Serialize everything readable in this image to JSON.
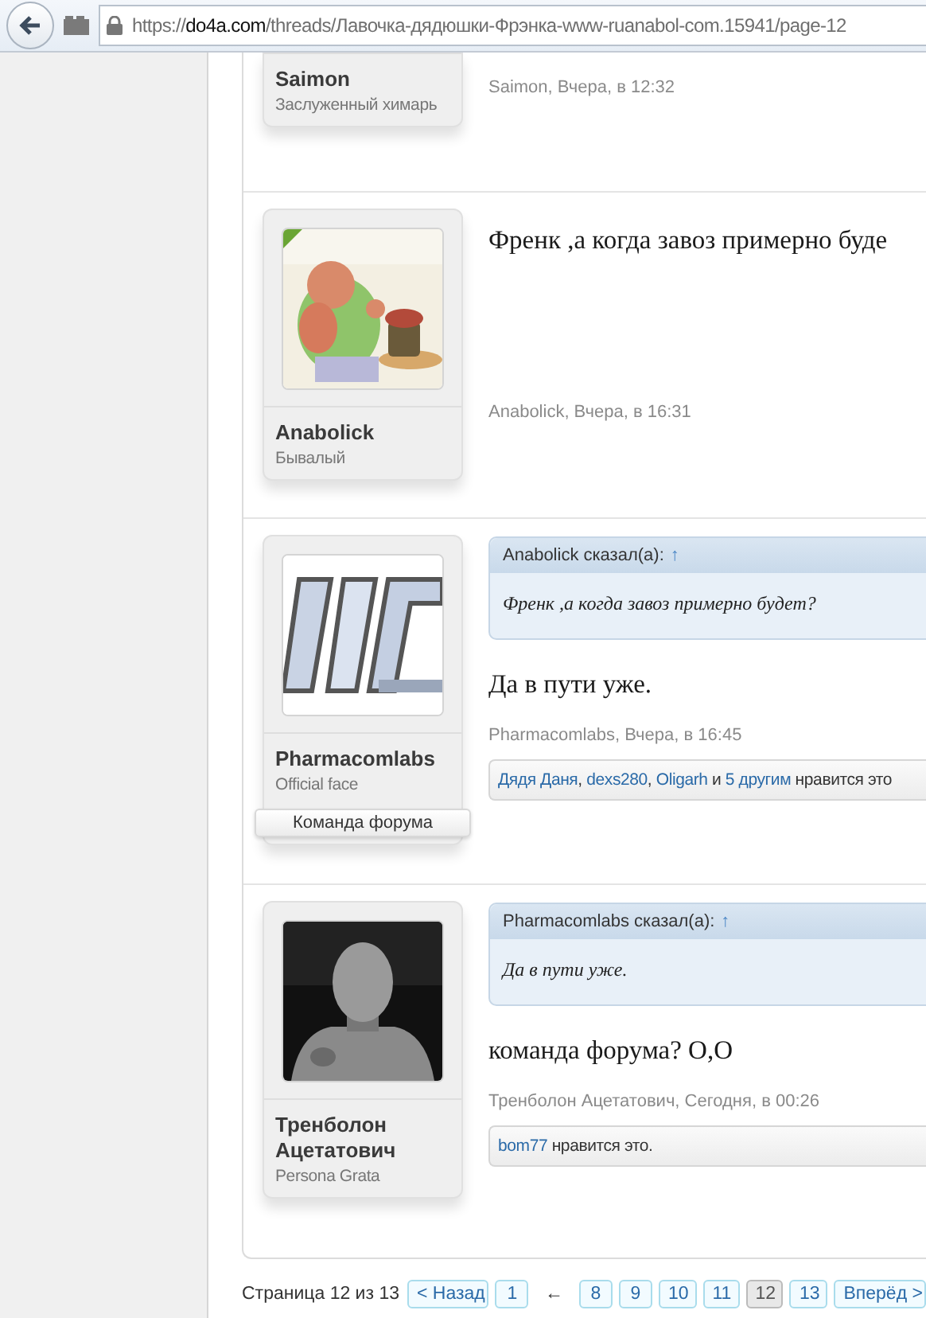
{
  "browser": {
    "url": {
      "scheme": "https://",
      "host": "do4a.com",
      "path": "/threads/Лавочка-дядюшки-Фрэнка-www-ruanabol-com.15941/page-12"
    }
  },
  "posts": [
    {
      "author": "Saimon",
      "user_title": "Заслуженный химарь",
      "byline": "Saimon, Вчера, в 12:32"
    },
    {
      "author": "Anabolick",
      "user_title": "Бывалый",
      "avatar": {
        "kind": "picture",
        "online": true
      },
      "message": "Френк ,а когда завоз примерно буде",
      "byline": "Anabolick, Вчера, в 16:31"
    },
    {
      "author": "Pharmacomlabs",
      "user_title": "Official face",
      "badge": "Команда форума",
      "avatar": {
        "kind": "picture",
        "online": false
      },
      "quote": {
        "header": "Anabolick сказал(а):",
        "arrow": "↑",
        "text": "Френк ,а когда завоз примерно будет?"
      },
      "message": "Да в пути уже.",
      "byline": "Pharmacomlabs, Вчера, в 16:45",
      "likes": [
        {
          "kind": "link",
          "text": "Дядя Даня"
        },
        {
          "kind": "plain",
          "text": ", "
        },
        {
          "kind": "link",
          "text": "dexs280"
        },
        {
          "kind": "plain",
          "text": ", "
        },
        {
          "kind": "link",
          "text": "Oligarh"
        },
        {
          "kind": "plain",
          "text": " и "
        },
        {
          "kind": "link",
          "text": "5 другим"
        },
        {
          "kind": "plain",
          "text": " нравится это"
        }
      ]
    },
    {
      "author": "Тренболон Ацетатович",
      "user_title": "Persona Grata",
      "avatar": {
        "kind": "picture",
        "online": false
      },
      "quote": {
        "header": "Pharmacomlabs сказал(а):",
        "arrow": "↑",
        "text": "Да в пути уже."
      },
      "message": "команда форума? О,О",
      "byline": "Тренболон Ацетатович, Сегодня, в 00:26",
      "likes": [
        {
          "kind": "link",
          "text": "bom77"
        },
        {
          "kind": "plain",
          "text": " нравится это."
        }
      ]
    }
  ],
  "pagination": {
    "label": "Страница 12 из 13",
    "items": [
      {
        "kind": "nav",
        "text": "< Назад"
      },
      {
        "kind": "page",
        "text": "1",
        "selected": false
      },
      {
        "kind": "gap",
        "text": "←"
      },
      {
        "kind": "page",
        "text": "8",
        "selected": false
      },
      {
        "kind": "page",
        "text": "9",
        "selected": false
      },
      {
        "kind": "page",
        "text": "10",
        "selected": false
      },
      {
        "kind": "page",
        "text": "11",
        "selected": false
      },
      {
        "kind": "page",
        "text": "12",
        "selected": true
      },
      {
        "kind": "page",
        "text": "13",
        "selected": false
      },
      {
        "kind": "nav",
        "text": "Вперёд >"
      }
    ]
  }
}
